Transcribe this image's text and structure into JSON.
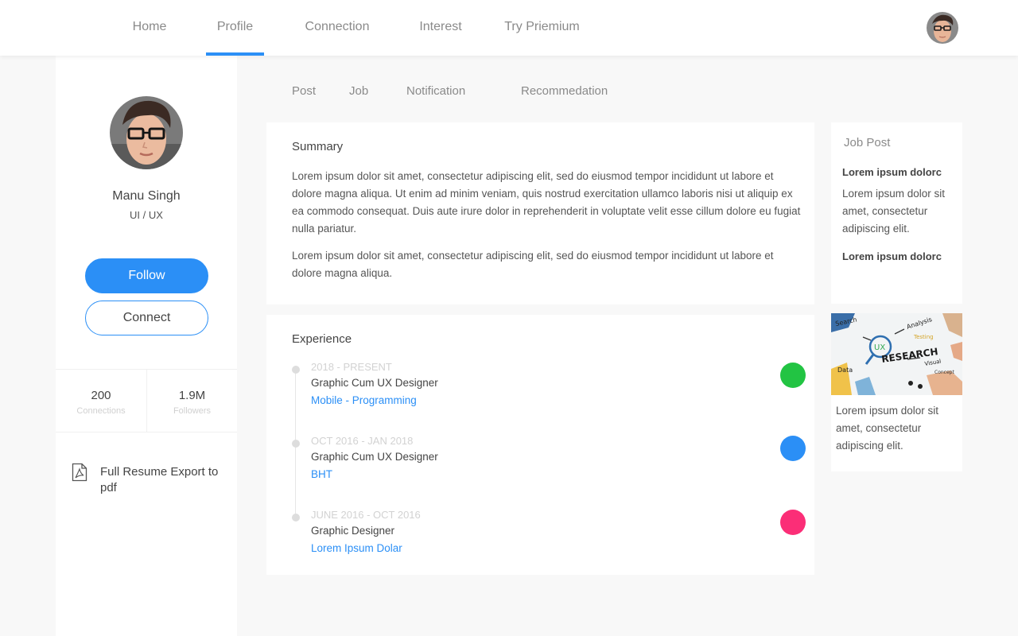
{
  "nav": {
    "items": [
      {
        "label": "Home"
      },
      {
        "label": "Profile"
      },
      {
        "label": "Connection"
      },
      {
        "label": "Interest"
      },
      {
        "label": "Try Priemium"
      }
    ],
    "active_index": 1
  },
  "profile": {
    "name": "Manu Singh",
    "role": "UI / UX",
    "follow_label": "Follow",
    "connect_label": "Connect",
    "stats": [
      {
        "value": "200",
        "label": "Connections"
      },
      {
        "value": "1.9M",
        "label": "Followers"
      }
    ],
    "resume_label": "Full Resume Export to pdf"
  },
  "subtabs": [
    "Post",
    "Job",
    "Notification",
    "Recommedation"
  ],
  "summary": {
    "title": "Summary",
    "paragraphs": [
      "Lorem ipsum dolor sit amet, consectetur adipiscing elit, sed do eiusmod tempor incididunt ut labore et dolore magna aliqua. Ut enim ad minim veniam, quis nostrud exercitation ullamco laboris nisi ut aliquip ex ea commodo consequat. Duis aute irure dolor in reprehenderit in voluptate velit esse cillum dolore eu fugiat nulla pariatur.",
      "Lorem ipsum dolor sit amet, consectetur adipiscing elit, sed do eiusmod tempor incididunt ut labore et dolore magna aliqua."
    ]
  },
  "experience": {
    "title": "Experience",
    "items": [
      {
        "date": "2018 - PRESENT",
        "title": "Graphic Cum UX Designer",
        "company": "Mobile - Programming",
        "color": "#22c443"
      },
      {
        "date": "OCT 2016 - JAN 2018",
        "title": "Graphic Cum UX Designer",
        "company": "BHT",
        "color": "#2b8ff6"
      },
      {
        "date": "JUNE 2016 - OCT 2016",
        "title": "Graphic Designer",
        "company": "Lorem Ipsum Dolar",
        "color": "#fb2e77"
      }
    ]
  },
  "job_post": {
    "title": "Job Post",
    "heading1": "Lorem ipsum dolorc",
    "text1": "Lorem ipsum dolor sit amet, consectetur adipiscing elit.",
    "heading2": "Lorem ipsum dolorc"
  },
  "ad": {
    "image_words": {
      "search": "Search",
      "analysis": "Analysis",
      "testing": "Testing",
      "ux": "UX",
      "research": "RESEARCH",
      "data": "Data",
      "visual": "Visual",
      "concept": "Concept"
    },
    "text": "Lorem ipsum dolor sit amet, consectetur adipiscing elit."
  },
  "colors": {
    "accent": "#2b8ff6",
    "green": "#22c443",
    "pink": "#fb2e77"
  }
}
